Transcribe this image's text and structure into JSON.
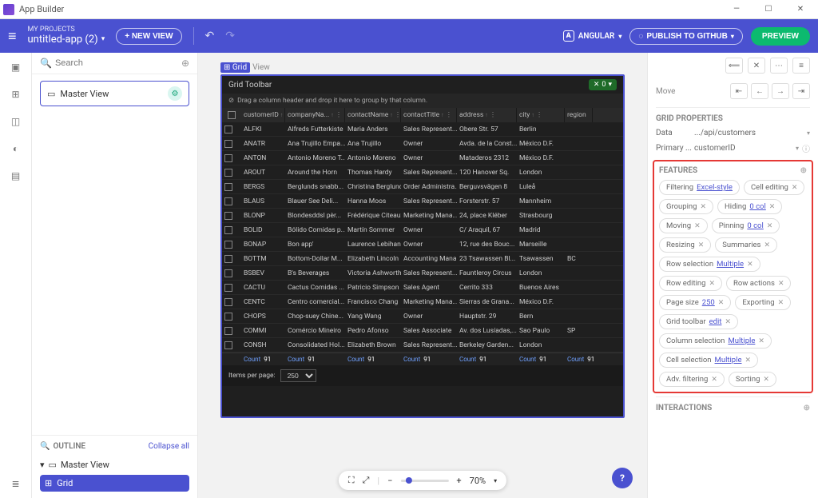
{
  "titleBar": {
    "title": "App Builder"
  },
  "header": {
    "myProjects": "MY PROJECTS",
    "appName": "untitled-app (2)",
    "newView": "+ NEW VIEW",
    "framework": "ANGULAR",
    "publish": "PUBLISH TO GITHUB",
    "preview": "PREVIEW"
  },
  "leftPanel": {
    "searchPlaceholder": "Search",
    "masterView": "Master View",
    "outline": "OUTLINE",
    "collapse": "Collapse all",
    "treeRoot": "Master View",
    "treeChild": "Grid"
  },
  "canvas": {
    "gridLabel": "Grid",
    "viewLabel": "View",
    "toolbarLabel": "Grid Toolbar",
    "excelCount": "0",
    "groupHint": "Drag a column header and drop it here to group by that column.",
    "headers": {
      "id": "customerID",
      "company": "companyNa...",
      "contact": "contactName",
      "title": "contactTitle",
      "address": "address",
      "city": "city",
      "region": "region"
    },
    "footerCount": "Count",
    "footerVal": "91",
    "pagerLabel": "Items per page:",
    "pageSize": "250"
  },
  "rows": [
    {
      "id": "ALFKI",
      "company": "Alfreds Futterkiste",
      "contact": "Maria Anders",
      "title": "Sales Represent...",
      "address": "Obere Str. 57",
      "city": "Berlin",
      "region": ""
    },
    {
      "id": "ANATR",
      "company": "Ana Trujillo Empa...",
      "contact": "Ana Trujillo",
      "title": "Owner",
      "address": "Avda. de la Const...",
      "city": "México D.F.",
      "region": ""
    },
    {
      "id": "ANTON",
      "company": "Antonio Moreno T...",
      "contact": "Antonio Moreno",
      "title": "Owner",
      "address": "Mataderos 2312",
      "city": "México D.F.",
      "region": ""
    },
    {
      "id": "AROUT",
      "company": "Around the Horn",
      "contact": "Thomas Hardy",
      "title": "Sales Represent...",
      "address": "120 Hanover Sq.",
      "city": "London",
      "region": ""
    },
    {
      "id": "BERGS",
      "company": "Berglunds snabb...",
      "contact": "Christina Berglund",
      "title": "Order Administra...",
      "address": "Berguvsvägen 8",
      "city": "Luleå",
      "region": ""
    },
    {
      "id": "BLAUS",
      "company": "Blauer See Deli...",
      "contact": "Hanna Moos",
      "title": "Sales Represent...",
      "address": "Forsterstr. 57",
      "city": "Mannheim",
      "region": ""
    },
    {
      "id": "BLONP",
      "company": "Blondesddsl pèr...",
      "contact": "Frédérique Citeaux",
      "title": "Marketing Mana...",
      "address": "24, place Kléber",
      "city": "Strasbourg",
      "region": ""
    },
    {
      "id": "BOLID",
      "company": "Bólido Comidas p...",
      "contact": "Martín Sommer",
      "title": "Owner",
      "address": "C/ Araquil, 67",
      "city": "Madrid",
      "region": ""
    },
    {
      "id": "BONAP",
      "company": "Bon app'",
      "contact": "Laurence Lebihan",
      "title": "Owner",
      "address": "12, rue des Bouc...",
      "city": "Marseille",
      "region": ""
    },
    {
      "id": "BOTTM",
      "company": "Bottom-Dollar M...",
      "contact": "Elizabeth Lincoln",
      "title": "Accounting Mana...",
      "address": "23 Tsawassen Bl...",
      "city": "Tsawassen",
      "region": "BC"
    },
    {
      "id": "BSBEV",
      "company": "B's Beverages",
      "contact": "Victoria Ashworth",
      "title": "Sales Represent...",
      "address": "Fauntleroy Circus",
      "city": "London",
      "region": ""
    },
    {
      "id": "CACTU",
      "company": "Cactus Comidas ...",
      "contact": "Patricio Simpson",
      "title": "Sales Agent",
      "address": "Cerrito 333",
      "city": "Buenos Aires",
      "region": ""
    },
    {
      "id": "CENTC",
      "company": "Centro comercial...",
      "contact": "Francisco Chang",
      "title": "Marketing Mana...",
      "address": "Sierras de Grana...",
      "city": "México D.F.",
      "region": ""
    },
    {
      "id": "CHOPS",
      "company": "Chop-suey Chine...",
      "contact": "Yang Wang",
      "title": "Owner",
      "address": "Hauptstr. 29",
      "city": "Bern",
      "region": ""
    },
    {
      "id": "COMMI",
      "company": "Comércio Mineiro",
      "contact": "Pedro Afonso",
      "title": "Sales Associate",
      "address": "Av. dos Lusíadas,...",
      "city": "Sao Paulo",
      "region": "SP"
    },
    {
      "id": "CONSH",
      "company": "Consolidated Hol...",
      "contact": "Elizabeth Brown",
      "title": "Sales Represent...",
      "address": "Berkeley Garden...",
      "city": "London",
      "region": ""
    }
  ],
  "zoom": {
    "value": "70%"
  },
  "rightPanel": {
    "move": "Move",
    "gridProps": "GRID PROPERTIES",
    "data": "Data",
    "dataVal": ".../api/customers",
    "primary": "Primary ...",
    "primaryVal": "customerID",
    "features": "FEATURES",
    "interactions": "INTERACTIONS"
  },
  "featureChips": [
    {
      "label": "Filtering",
      "val": "Excel-style",
      "x": false
    },
    {
      "label": "Cell editing",
      "x": true
    },
    {
      "label": "Grouping",
      "x": true
    },
    {
      "label": "Hiding",
      "val": "0 col",
      "x": true
    },
    {
      "label": "Moving",
      "x": true
    },
    {
      "label": "Pinning",
      "val": "0 col",
      "x": true
    },
    {
      "label": "Resizing",
      "x": true
    },
    {
      "label": "Summaries",
      "x": true
    },
    {
      "label": "Row selection",
      "val": "Multiple",
      "x": true
    },
    {
      "label": "Row editing",
      "x": true
    },
    {
      "label": "Row actions",
      "x": true
    },
    {
      "label": "Page size",
      "val": "250",
      "x": true
    },
    {
      "label": "Exporting",
      "x": true
    },
    {
      "label": "Grid toolbar",
      "val": "edit",
      "x": true
    },
    {
      "label": "Column selection",
      "val": "Multiple",
      "x": true
    },
    {
      "label": "Cell selection",
      "val": "Multiple",
      "x": true
    },
    {
      "label": "Adv. filtering",
      "x": true
    },
    {
      "label": "Sorting",
      "x": true
    }
  ]
}
